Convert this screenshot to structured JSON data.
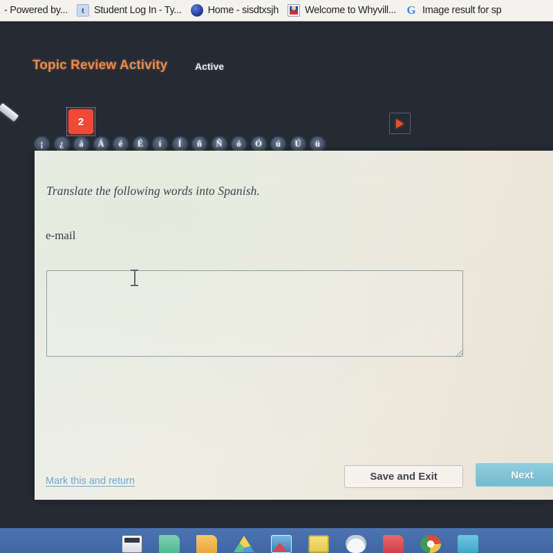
{
  "browser": {
    "bookmarks": [
      {
        "label": "- Powered by...",
        "icon": "none"
      },
      {
        "label": "Student Log In - Ty...",
        "icon": "twitter-icon"
      },
      {
        "label": "Home - sisdtxsjh",
        "icon": "globe-icon"
      },
      {
        "label": "Welcome to Whyvill...",
        "icon": "whyville-avatar-icon"
      },
      {
        "label": "Image result for sp",
        "icon": "google-g-icon"
      }
    ]
  },
  "activity": {
    "title": "Topic Review Activity",
    "status": "Active",
    "question_number": "2",
    "forward_icon": "play-triangle-icon",
    "pencil_icon": "pencil-icon",
    "accent_keys": [
      "¡",
      "¿",
      "á",
      "Á",
      "é",
      "É",
      "í",
      "Í",
      "ñ",
      "Ñ",
      "ó",
      "Ó",
      "ú",
      "Ú",
      "ü"
    ]
  },
  "question": {
    "prompt": "Translate the following words into Spanish.",
    "word": "e-mail",
    "answer_value": "",
    "answer_placeholder": ""
  },
  "footer": {
    "mark_return_label": "Mark this and return",
    "save_exit_label": "Save and Exit",
    "next_label": "Next"
  },
  "taskbar": {
    "icons": [
      "calculator-icon",
      "green-document-icon",
      "yellow-folder-icon",
      "google-drive-icon",
      "photos-icon",
      "sticky-note-icon",
      "cloud-icon",
      "pdf-document-icon",
      "chrome-icon",
      "blue-app-icon"
    ]
  },
  "colors": {
    "accent_orange": "#e98a4c",
    "question_chip_red": "#ef4a37",
    "next_button_teal": "#74bace",
    "link_blue": "#6fa7cf",
    "dark_background": "#252b35",
    "taskbar_blue": "#4a74b0"
  }
}
